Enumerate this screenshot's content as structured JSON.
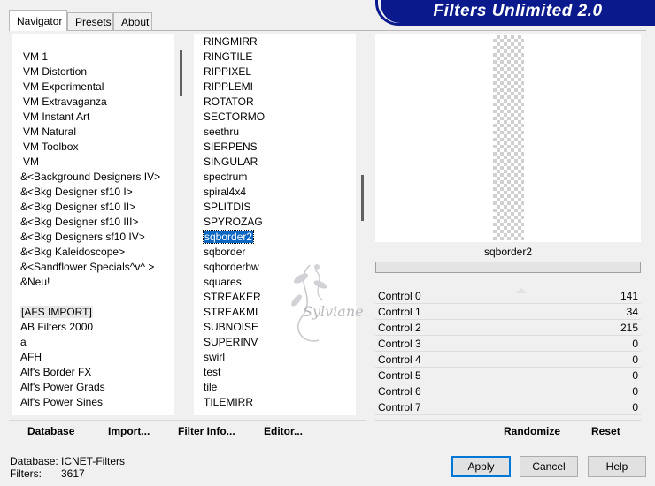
{
  "app": {
    "title": "Filters Unlimited 2.0"
  },
  "tabs": [
    {
      "label": "Navigator",
      "active": true
    },
    {
      "label": "Presets",
      "active": false
    },
    {
      "label": "About",
      "active": false
    }
  ],
  "categories": {
    "items": [
      "VM 1",
      "VM Distortion",
      "VM Experimental",
      "VM Extravaganza",
      "VM Instant Art",
      "VM Natural",
      "VM Toolbox",
      "VM",
      "&<Background Designers IV>",
      "&<Bkg Designer sf10 I>",
      "&<Bkg Designer sf10 II>",
      "&<Bkg Designer sf10 III>",
      "&<Bkg Designers sf10 IV>",
      "&<Bkg Kaleidoscope>",
      "&<Sandflower Specials^v^ >",
      "&Neu!",
      "",
      "[AFS IMPORT]",
      "AB Filters 2000",
      "a",
      "AFH",
      "Alf's Border FX",
      "Alf's Power Grads",
      "Alf's Power Sines"
    ],
    "highlighted": "[AFS IMPORT]"
  },
  "filters": {
    "items": [
      "RINGMIRR",
      "RINGTILE",
      "RIPPIXEL",
      "RIPPLEMI",
      "ROTATOR",
      "SECTORMO",
      "seethru",
      "SIERPENS",
      "SINGULAR",
      "spectrum",
      "spiral4x4",
      "SPLITDIS",
      "SPYROZAG",
      "sqborder2",
      "sqborder",
      "sqborderbw",
      "squares",
      "STREAKER",
      "STREAKMI",
      "SUBNOISE",
      "SUPERINV",
      "swirl",
      "test",
      "tile",
      "TILEMIRR"
    ],
    "selected": "sqborder2"
  },
  "preview": {
    "filter_name": "sqborder2"
  },
  "controls": [
    {
      "label": "Control 0",
      "value": "141"
    },
    {
      "label": "Control 1",
      "value": "34"
    },
    {
      "label": "Control 2",
      "value": "215"
    },
    {
      "label": "Control 3",
      "value": "0"
    },
    {
      "label": "Control 4",
      "value": "0"
    },
    {
      "label": "Control 5",
      "value": "0"
    },
    {
      "label": "Control 6",
      "value": "0"
    },
    {
      "label": "Control 7",
      "value": "0"
    }
  ],
  "toolbar": {
    "database_label": "Database",
    "import_label": "Import...",
    "filter_info_label": "Filter Info...",
    "editor_label": "Editor...",
    "randomize_label": "Randomize",
    "reset_label": "Reset"
  },
  "status": {
    "database_key": "Database:",
    "database_value": "ICNET-Filters",
    "filters_key": "Filters:",
    "filters_value": "3617"
  },
  "buttons": {
    "apply": "Apply",
    "cancel": "Cancel",
    "help": "Help"
  },
  "watermark": {
    "text": "Sylviane"
  }
}
